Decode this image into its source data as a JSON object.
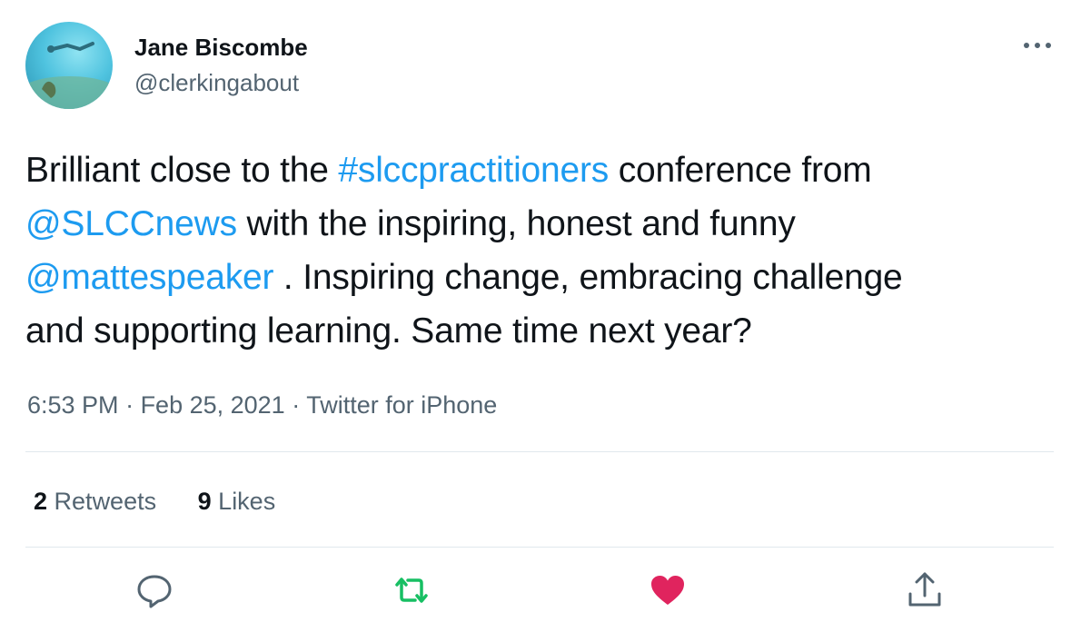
{
  "user": {
    "display_name": "Jane Biscombe",
    "handle": "@clerkingabout"
  },
  "tweet": {
    "lines": [
      [
        {
          "text": "Brilliant close to the ",
          "link": false
        },
        {
          "text": "#slccpractitioners",
          "link": true
        },
        {
          "text": " conference from",
          "link": false
        }
      ],
      [
        {
          "text": "@SLCCnews",
          "link": true
        },
        {
          "text": " with the inspiring, honest and funny",
          "link": false
        }
      ],
      [
        {
          "text": "@mattespeaker",
          "link": true
        },
        {
          "text": " . Inspiring change, embracing challenge",
          "link": false
        }
      ],
      [
        {
          "text": "and supporting learning. Same time next year?",
          "link": false
        }
      ]
    ]
  },
  "meta": {
    "time": "6:53 PM",
    "sep1": " · ",
    "date": "Feb 25, 2021",
    "sep2": " · ",
    "source": "Twitter for iPhone"
  },
  "stats": {
    "retweets_count": "2",
    "retweets_label": "Retweets",
    "likes_count": "9",
    "likes_label": "Likes"
  },
  "actions": {
    "reply_icon": "reply-icon",
    "retweet_icon": "retweet-icon",
    "like_icon": "heart-icon",
    "share_icon": "share-icon"
  },
  "colors": {
    "link": "#1d9bf0",
    "secondary_text": "#536471",
    "retweeted": "#17bf63",
    "liked": "#e0245e",
    "divider": "#e1e8ed"
  }
}
